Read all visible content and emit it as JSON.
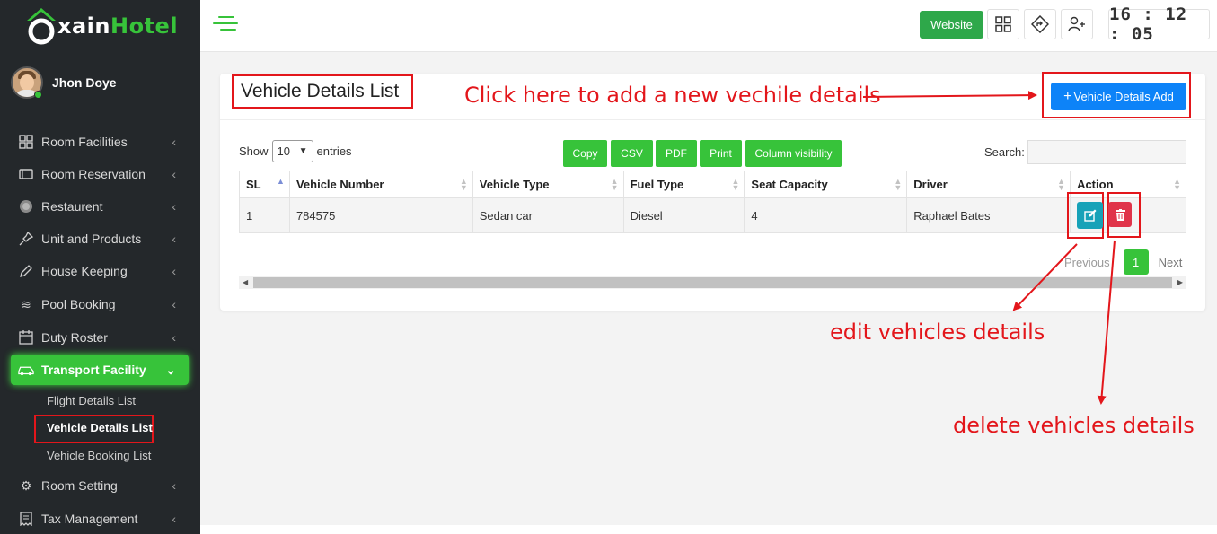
{
  "app": {
    "logo_text_main": "xain",
    "logo_text_accent": "Hotel",
    "user_name": "Jhon Doye"
  },
  "sidebar": {
    "items": [
      {
        "label": "Room Facilities",
        "icon": "grid-icon"
      },
      {
        "label": "Room Reservation",
        "icon": "tv-icon"
      },
      {
        "label": "Restaurent",
        "icon": "restaurant-icon"
      },
      {
        "label": "Unit and Products",
        "icon": "pin-icon"
      },
      {
        "label": "House Keeping",
        "icon": "edit-icon"
      },
      {
        "label": "Pool Booking",
        "icon": "waves-icon"
      },
      {
        "label": "Duty Roster",
        "icon": "calendar-icon"
      },
      {
        "label": "Transport Facility",
        "icon": "car-icon"
      },
      {
        "label": "Room Setting",
        "icon": "gear-icon"
      },
      {
        "label": "Tax Management",
        "icon": "receipt-icon"
      }
    ],
    "sub_items": [
      {
        "label": "Flight Details List"
      },
      {
        "label": "Vehicle Details List"
      },
      {
        "label": "Vehicle Booking List"
      }
    ]
  },
  "topbar": {
    "website_label": "Website",
    "clock": "16 : 12 : 05"
  },
  "page": {
    "title": "Vehicle Details List",
    "add_button": "Vehicle Details Add",
    "show_label": "Show",
    "entries_value": "10",
    "entries_label": "entries",
    "search_label": "Search:",
    "export_buttons": [
      "Copy",
      "CSV",
      "PDF",
      "Print",
      "Column visibility"
    ]
  },
  "table": {
    "columns": [
      "SL",
      "Vehicle Number",
      "Vehicle Type",
      "Fuel Type",
      "Seat Capacity",
      "Driver",
      "Action"
    ],
    "rows": [
      [
        "1",
        "784575",
        "Sedan car",
        "Diesel",
        "4",
        "Raphael Bates"
      ]
    ]
  },
  "pagination": {
    "previous": "Previous",
    "current": "1",
    "next": "Next"
  },
  "annotations": {
    "add_hint": "Click here to add a new vechile details",
    "edit_hint": "edit vehicles details",
    "delete_hint": "delete vehicles details"
  },
  "colors": {
    "brand_green": "#37c33a",
    "primary_blue": "#0d83f8",
    "annotation_red": "#e3161b"
  }
}
